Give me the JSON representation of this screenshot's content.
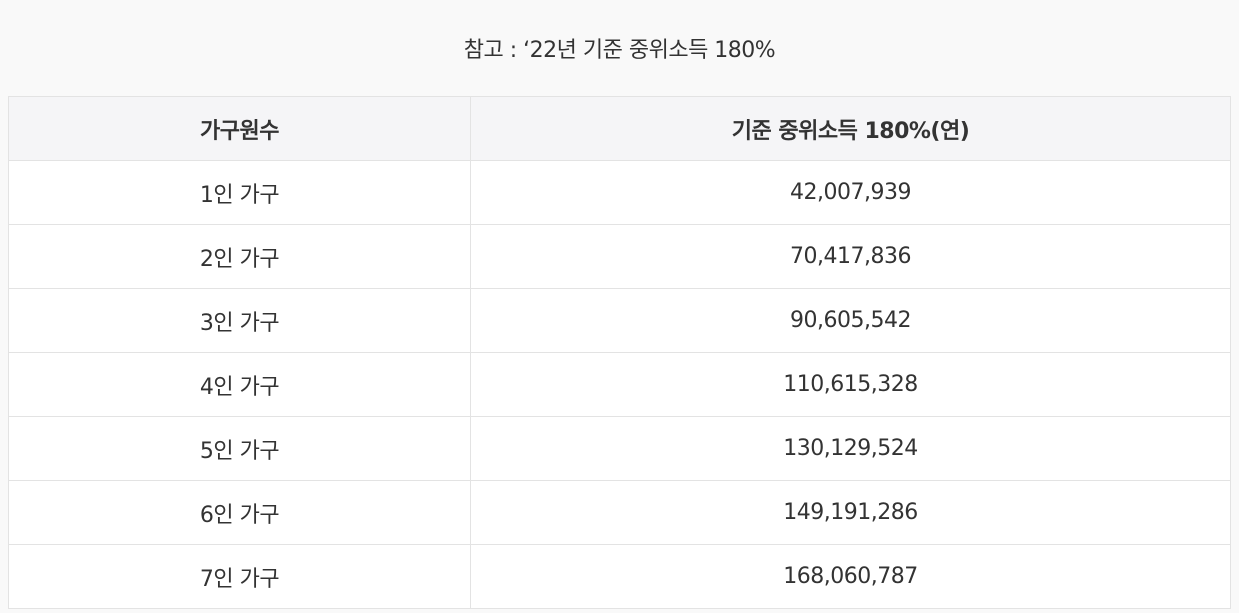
{
  "caption": "참고 : ‘22년 기준 중위소득 180%",
  "table": {
    "headers": [
      "가구원수",
      "기준 중위소득 180%(연)"
    ],
    "rows": [
      [
        "1인 가구",
        "42,007,939"
      ],
      [
        "2인 가구",
        "70,417,836"
      ],
      [
        "3인 가구",
        "90,605,542"
      ],
      [
        "4인 가구",
        "110,615,328"
      ],
      [
        "5인 가구",
        "130,129,524"
      ],
      [
        "6인 가구",
        "149,191,286"
      ],
      [
        "7인 가구",
        "168,060,787"
      ]
    ]
  },
  "colors": {
    "background": "#f9f9f9",
    "header_bg": "#f5f5f7",
    "border": "#e3e3e3",
    "text": "#333333"
  }
}
